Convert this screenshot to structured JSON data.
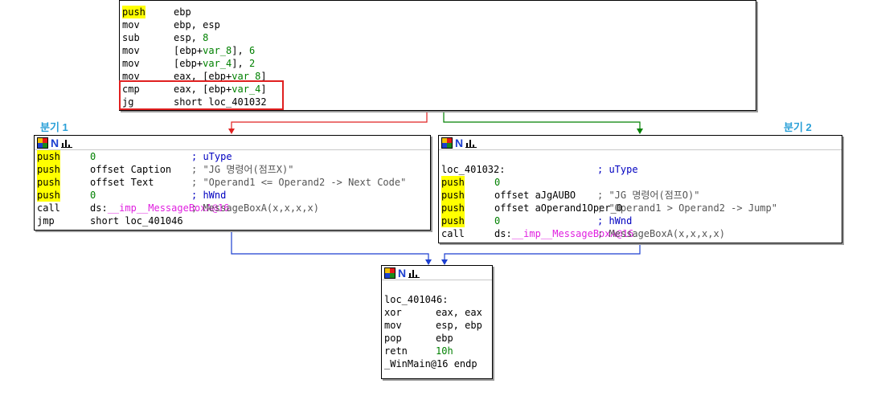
{
  "branch_labels": {
    "left": "분기 1",
    "right": "분기 2"
  },
  "icons": {
    "graph_header": [
      "color-grid-icon",
      "n-icon",
      "bar-chart-icon"
    ]
  },
  "colors": {
    "branch_false": "#e02020",
    "branch_true": "#008000",
    "unconditional": "#1c3fd0",
    "highlight": "#ffff00"
  },
  "top_block": {
    "lines": [
      {
        "mn": "push",
        "op": "ebp"
      },
      {
        "mn": "mov",
        "op": "ebp, esp"
      },
      {
        "mn": "sub",
        "op": "esp, 8"
      },
      {
        "mn": "mov",
        "op": "[ebp+var_8], 6"
      },
      {
        "mn": "mov",
        "op": "[ebp+var_4], 2"
      },
      {
        "mn": "mov",
        "op": "eax, [ebp+var_8]"
      },
      {
        "mn": "cmp",
        "op": "eax, [ebp+var_4]"
      },
      {
        "mn": "jg",
        "op": "short loc_401032"
      }
    ]
  },
  "left_block": {
    "lines": [
      {
        "mn": "push",
        "op": "0",
        "cm": "; uType"
      },
      {
        "mn": "push",
        "op": "offset Caption",
        "cm": "; \"JG 명령어(점프X)\""
      },
      {
        "mn": "push",
        "op": "offset Text",
        "cm": "; \"Operand1 <= Operand2 -> Next Code\""
      },
      {
        "mn": "push",
        "op": "0",
        "cm": "; hWnd"
      },
      {
        "mn": "call",
        "op": "ds:__imp__MessageBoxA@16",
        "cm": "; MessageBoxA(x,x,x,x)"
      },
      {
        "mn": "jmp",
        "op": "short loc_401046",
        "cm": ""
      }
    ]
  },
  "right_block": {
    "label": "loc_401032:",
    "label_comment": "; uType",
    "lines": [
      {
        "mn": "push",
        "op": "0",
        "cm": ""
      },
      {
        "mn": "push",
        "op": "offset aJgAUBO",
        "cm": "; \"JG 명령어(점프O)\""
      },
      {
        "mn": "push",
        "op": "offset aOperand1Oper_0",
        "cm": "; \"Operand1 > Operand2 -> Jump\""
      },
      {
        "mn": "push",
        "op": "0",
        "cm": "; hWnd"
      },
      {
        "mn": "call",
        "op": "ds:__imp__MessageBoxA@16",
        "cm": "; MessageBoxA(x,x,x,x)"
      }
    ]
  },
  "bottom_block": {
    "label": "loc_401046:",
    "lines": [
      {
        "mn": "xor",
        "op": "eax, eax"
      },
      {
        "mn": "mov",
        "op": "esp, ebp"
      },
      {
        "mn": "pop",
        "op": "ebp"
      },
      {
        "mn": "retn",
        "op": "10h"
      }
    ],
    "endp": "_WinMain@16 endp"
  }
}
